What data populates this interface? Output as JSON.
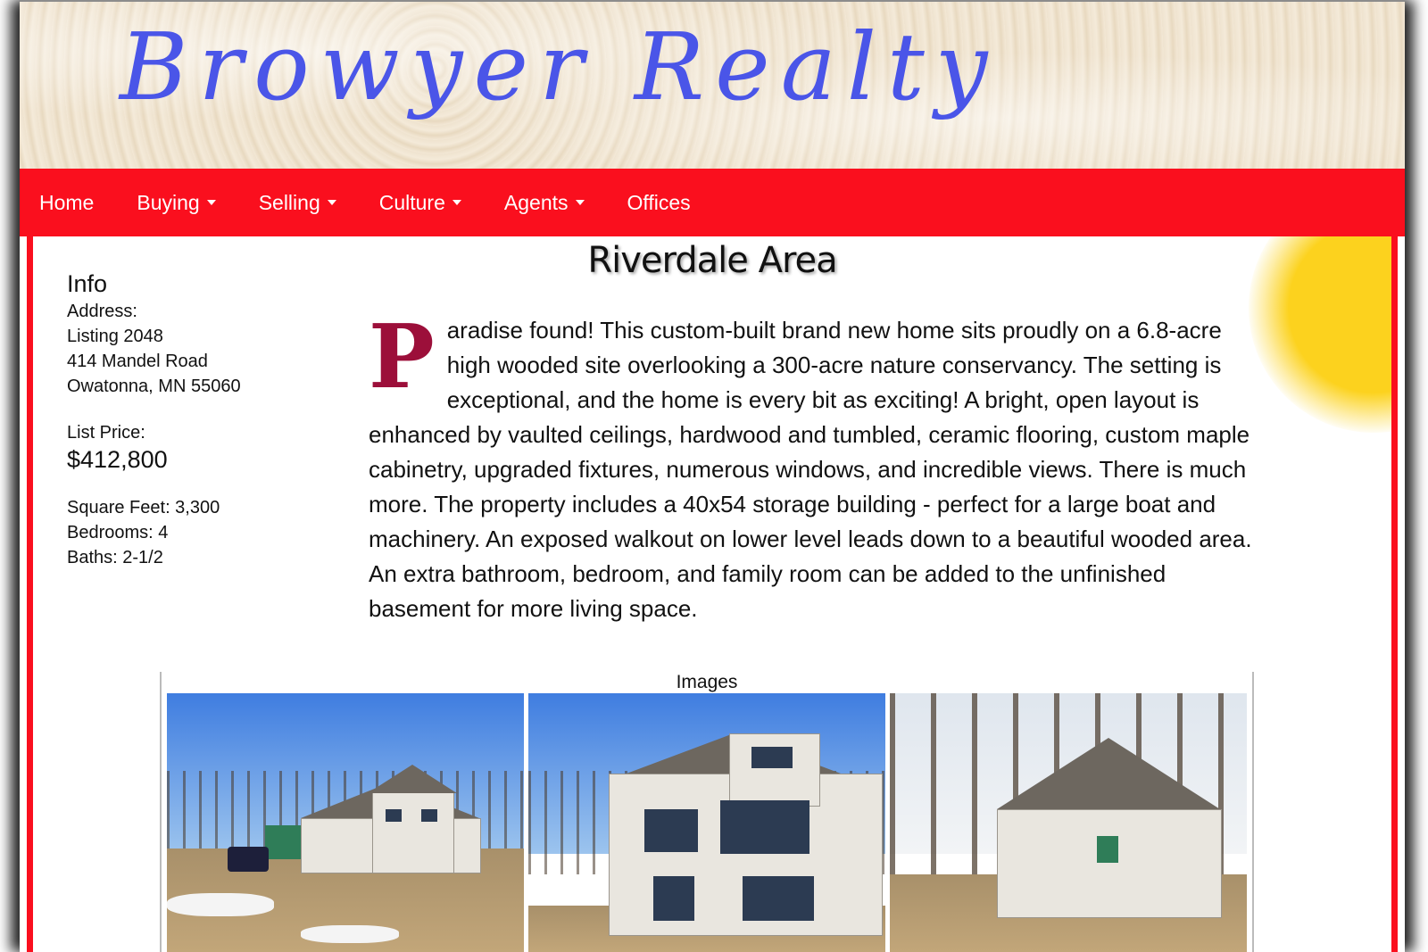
{
  "site": {
    "title": "Browyer Realty"
  },
  "nav": {
    "items": [
      {
        "label": "Home",
        "dropdown": false
      },
      {
        "label": "Buying",
        "dropdown": true
      },
      {
        "label": "Selling",
        "dropdown": true
      },
      {
        "label": "Culture",
        "dropdown": true
      },
      {
        "label": "Agents",
        "dropdown": true
      },
      {
        "label": "Offices",
        "dropdown": false
      }
    ]
  },
  "page": {
    "title": "Riverdale Area"
  },
  "info": {
    "heading": "Info",
    "address_label": "Address:",
    "listing": "Listing 2048",
    "street": "414 Mandel Road",
    "city": "Owatonna, MN 55060",
    "price_label": "List Price:",
    "price": "$412,800",
    "square_feet": "Square Feet: 3,300",
    "bedrooms": "Bedrooms: 4",
    "baths": "Baths: 2-1/2"
  },
  "description": {
    "drop_cap": "P",
    "text": "aradise found! This custom-built brand new home sits proudly on a 6.8-acre high wooded site overlooking a 300-acre nature conservancy. The setting is exceptional, and the home is every bit as exciting! A bright, open layout is enhanced by vaulted ceilings, hardwood and tumbled, ceramic flooring, custom maple cabinetry, upgraded fixtures, numerous windows, and incredible views. There is much more. The property includes a 40x54 storage building - perfect for a large boat and machinery. An exposed walkout on lower level leads down to a beautiful wooded area. An extra bathroom, bedroom, and family room can be added to the unfinished basement for more living space."
  },
  "gallery": {
    "title": "Images",
    "images": [
      "house-front-photo",
      "house-rear-photo",
      "house-side-photo"
    ]
  },
  "colors": {
    "nav_red": "#fa0f1e",
    "title_blue": "#4a55e8",
    "drop_cap": "#9c0f3a",
    "sun_yellow": "#fcd21e"
  }
}
